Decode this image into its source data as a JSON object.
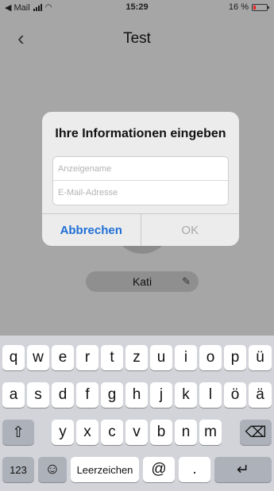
{
  "status_bar": {
    "back_app": "◀ Mail",
    "time": "15:29",
    "battery": "16 %"
  },
  "nav": {
    "back_icon": "‹",
    "title": "Test"
  },
  "profile": {
    "name": "Kati",
    "edit_icon": "✎"
  },
  "dialog": {
    "title": "Ihre Informationen eingeben",
    "name_placeholder": "Anzeigename",
    "email_placeholder": "E-Mail-Adresse",
    "cancel_label": "Abbrechen",
    "ok_label": "OK"
  },
  "keyboard": {
    "row1": [
      "q",
      "w",
      "e",
      "r",
      "t",
      "z",
      "u",
      "i",
      "o",
      "p",
      "ü"
    ],
    "row2": [
      "a",
      "s",
      "d",
      "f",
      "g",
      "h",
      "j",
      "k",
      "l",
      "ö",
      "ä"
    ],
    "row3": [
      "y",
      "x",
      "c",
      "v",
      "b",
      "n",
      "m"
    ],
    "shift_icon": "⇧",
    "backspace_icon": "⌫",
    "numbers_label": "123",
    "emoji_icon": "☺",
    "space_label": "Leerzeichen",
    "at_label": "@",
    "dot_label": ".",
    "return_icon": "↵"
  },
  "colors": {
    "accent": "#1f6fd6",
    "battery_low": "#e22222"
  }
}
